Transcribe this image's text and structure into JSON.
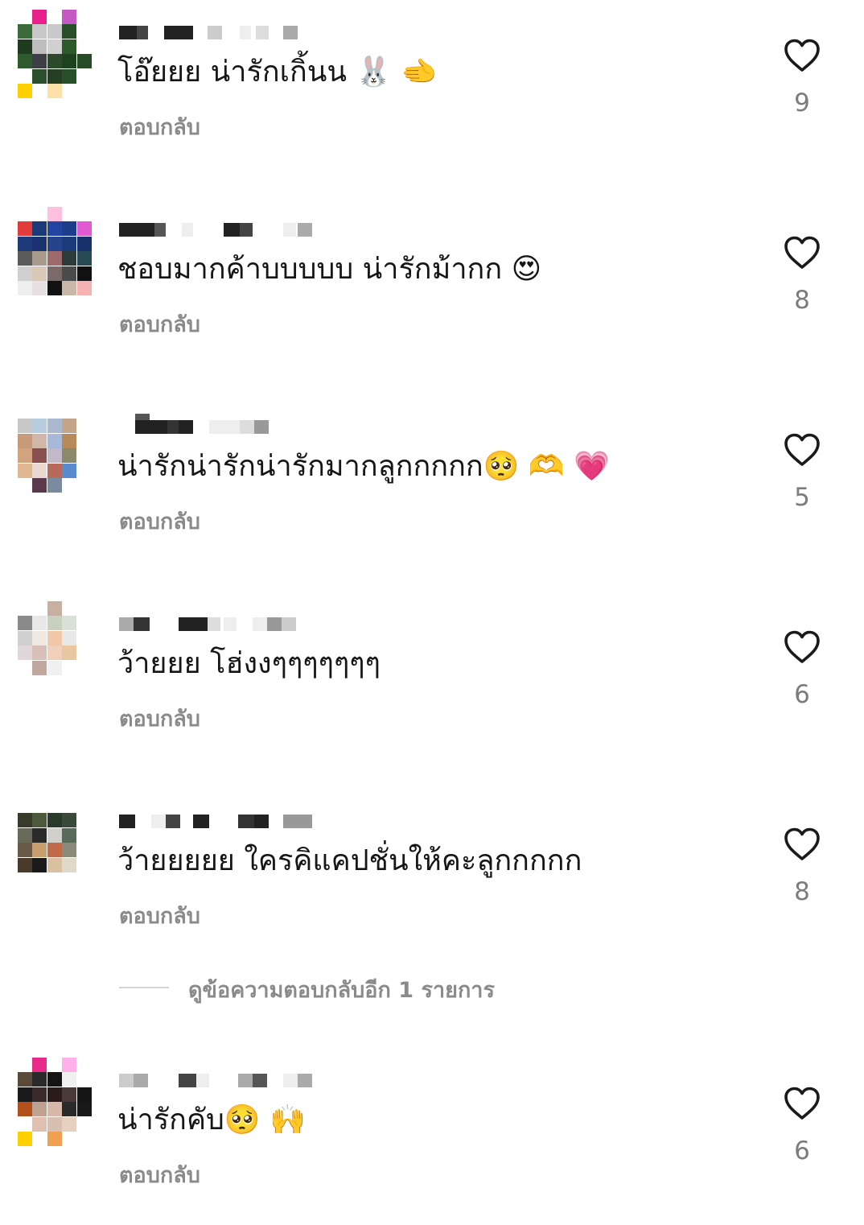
{
  "comments": [
    {
      "text": "โอ๊ยยย น่ารักเกิ้นน 🐰 🫲",
      "reply_label": "ตอบกลับ",
      "likes": "9",
      "avatar_colors": [
        "#ffffff",
        "#e8208a",
        "#ffffff",
        "#c459c4",
        "#ffffff",
        "#3b6b3b",
        "#c7c7c7",
        "#c9c9c9",
        "#2a4d2a",
        "#ffffff",
        "#1f3a1f",
        "#bdbdbd",
        "#d0d0d0",
        "#2d5a2d",
        "#ffffff",
        "#2e5a2e",
        "#3e3e46",
        "#2a4a2a",
        "#1e421e",
        "#274a27",
        "#ffffff",
        "#2a4f2a",
        "#243f24",
        "#284f28",
        "#ffffff",
        "#ffd000",
        "#ffffff",
        "#ffe0a8",
        "#ffffff",
        "#ffffff"
      ]
    },
    {
      "text": "ชอบมากค้าบบบบบ น่ารักม้ากก 😍",
      "reply_label": "ตอบกลับ",
      "likes": "8",
      "avatar_colors": [
        "#ffffff",
        "#ffffff",
        "#ffc0e0",
        "#ffffff",
        "#ffffff",
        "#e23b3b",
        "#1c3a7a",
        "#2145a0",
        "#1d3c8a",
        "#e25ad1",
        "#1f3a78",
        "#1a3270",
        "#24438a",
        "#1a3a7a",
        "#17326a",
        "#5b5b5b",
        "#a99c8c",
        "#9c6a6a",
        "#2d3b3b",
        "#274a55",
        "#cfcfcf",
        "#d9c8b8",
        "#7a6a6a",
        "#4b4b4b",
        "#111111",
        "#eeeeee",
        "#e8e0e0",
        "#111111",
        "#c9b8a8",
        "#f4b2b2"
      ]
    },
    {
      "text": "น่ารักน่ารักน่ารักมากลูกกกกก🥺 🫶 💗",
      "reply_label": "ตอบกลับ",
      "likes": "5",
      "avatar_colors": [
        "#ffffff",
        "#ffffff",
        "#ffffff",
        "#ffffff",
        "#ffffff",
        "#c8c8c8",
        "#b8cce0",
        "#aab8d0",
        "#c4a58a",
        "#ffffff",
        "#c89a7a",
        "#cfb8a8",
        "#a8b8d8",
        "#b88a5a",
        "#ffffff",
        "#d2a47e",
        "#8a5050",
        "#c2b8c8",
        "#8a8a6a",
        "#ffffff",
        "#e0b894",
        "#e8d8d0",
        "#b86a5a",
        "#5a8ad0",
        "#ffffff",
        "#ffffff",
        "#5a3a4a",
        "#7a8aa0",
        "#ffffff",
        "#ffffff"
      ]
    },
    {
      "text": "ว้ายยย โฮ่งงๆๆๆๆๆๆๆ",
      "reply_label": "ตอบกลับ",
      "likes": "6",
      "avatar_colors": [
        "#ffffff",
        "#ffffff",
        "#c8b0a0",
        "#ffffff",
        "#ffffff",
        "#8a8a8a",
        "#e8e8e8",
        "#c8d0c0",
        "#d8e0d8",
        "#ffffff",
        "#d0d0d0",
        "#f0e8e0",
        "#f0c8a8",
        "#e8e8e8",
        "#ffffff",
        "#e0d8d8",
        "#d8c0b8",
        "#f0d0b8",
        "#e8c8a0",
        "#ffffff",
        "#ffffff",
        "#c0a8a0",
        "#f0f0f0",
        "#ffffff",
        "#ffffff",
        "#ffffff",
        "#ffffff",
        "#ffffff",
        "#ffffff",
        "#ffffff"
      ]
    },
    {
      "text": "ว้ายยยยย ใครคิแคปชั่นให้คะลูกกกกก",
      "reply_label": "ตอบกลับ",
      "likes": "8",
      "avatar_colors": [
        "#ffffff",
        "#ffffff",
        "#ffffff",
        "#ffffff",
        "#ffffff",
        "#3a3a2a",
        "#4a5a3a",
        "#2a3a2a",
        "#3a4a3a",
        "#ffffff",
        "#6a6a5a",
        "#2a2a2a",
        "#d0d0c8",
        "#5a6a5a",
        "#ffffff",
        "#6a5a4a",
        "#c8a070",
        "#c06a4a",
        "#8a8a7a",
        "#ffffff",
        "#4a3a2a",
        "#1a1a1a",
        "#d8c0a0",
        "#e0d8c8",
        "#ffffff",
        "#ffffff",
        "#ffffff",
        "#ffffff",
        "#ffffff",
        "#ffffff"
      ]
    },
    {
      "text": "น่ารักคับ🥺 🙌",
      "reply_label": "ตอบกลับ",
      "likes": "6",
      "avatar_colors": [
        "#ffffff",
        "#e82a8a",
        "#ffffff",
        "#ffb0e8",
        "#ffffff",
        "#5a4a3a",
        "#2a2a2a",
        "#141414",
        "#f0f0f0",
        "#ffffff",
        "#1a1a1a",
        "#3a2a2a",
        "#2a1a1a",
        "#4a3a3a",
        "#141414",
        "#b0501a",
        "#c0a090",
        "#d8b8a8",
        "#2a2a2a",
        "#181818",
        "#ffffff",
        "#e0c0b0",
        "#d8c0b0",
        "#e8d0c0",
        "#ffffff",
        "#ffd000",
        "#ffffff",
        "#f0a050",
        "#ffffff",
        "#ffffff"
      ]
    }
  ],
  "view_more_replies": "ดูข้อความตอบกลับอีก 1 รายการ",
  "icons": {
    "like": "heart-outline-icon"
  },
  "colors": {
    "secondary_text": "#8a8a8a",
    "heart": "#1a1a1a"
  }
}
